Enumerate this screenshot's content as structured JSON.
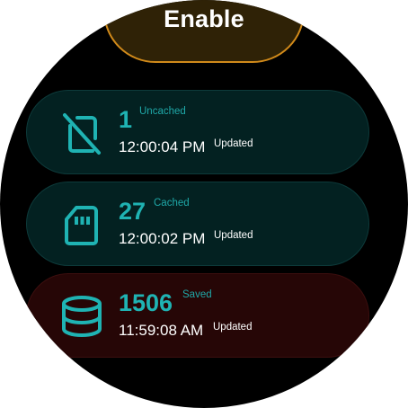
{
  "enable_button": {
    "label": "Enable",
    "color": "#d18a1a"
  },
  "cards": [
    {
      "count": "1",
      "tag": "Uncached",
      "time": "12:00:04 PM",
      "updated": "Updated",
      "icon": "sd-card-off-icon",
      "accent": "#1fb3b3"
    },
    {
      "count": "27",
      "tag": "Cached",
      "time": "12:00:02 PM",
      "updated": "Updated",
      "icon": "sd-card-icon",
      "accent": "#1fb3b3"
    },
    {
      "count": "1506",
      "tag": "Saved",
      "time": "11:59:08 AM",
      "updated": "Updated",
      "icon": "database-icon",
      "accent": "#1fb3b3"
    }
  ]
}
